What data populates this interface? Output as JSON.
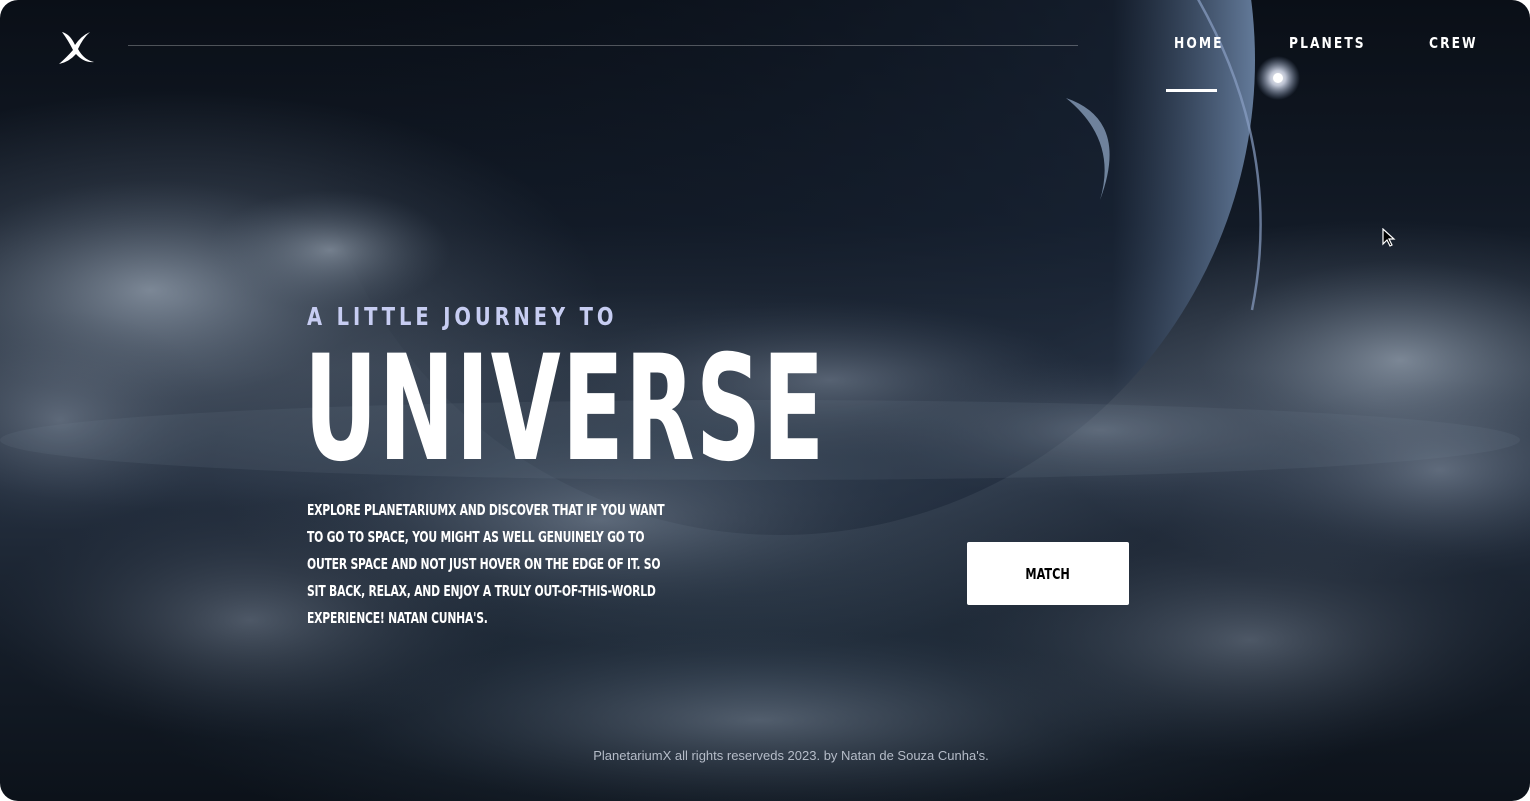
{
  "brand": {
    "logo_icon": "x-brush-logo-icon"
  },
  "nav": {
    "items": [
      {
        "label": "HOME",
        "active": true
      },
      {
        "label": "PLANETS",
        "active": false
      },
      {
        "label": "CREW",
        "active": false
      }
    ]
  },
  "hero": {
    "eyebrow": "A LITTLE JOURNEY TO",
    "title": "UNIVERSE",
    "description": "Explore PlanetariumX and discover that if you want to go to space, you might as well genuinely go to outer space and not just hover on the edge of it. So sit back, relax, and enjoy a truly out-of-this-world experience! Natan Cunha's.",
    "button_label": "MATCH"
  },
  "footer": {
    "text": "PlanetariumX all rights reserveds 2023. by Natan de Souza Cunha's."
  },
  "colors": {
    "eyebrow": "#c7cdf2",
    "text": "#ffffff",
    "button_bg": "#ffffff",
    "button_text": "#000000"
  }
}
